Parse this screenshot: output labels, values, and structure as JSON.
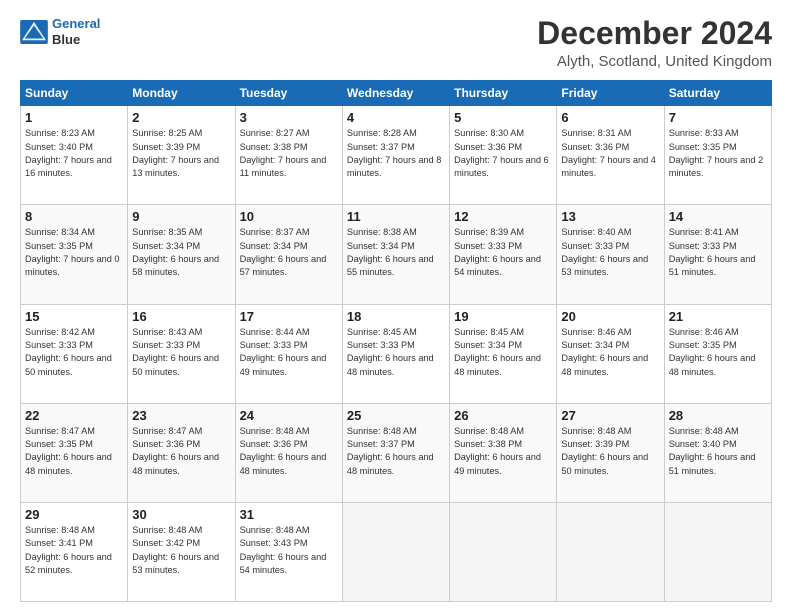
{
  "header": {
    "logo_line1": "General",
    "logo_line2": "Blue",
    "main_title": "December 2024",
    "subtitle": "Alyth, Scotland, United Kingdom"
  },
  "days_of_week": [
    "Sunday",
    "Monday",
    "Tuesday",
    "Wednesday",
    "Thursday",
    "Friday",
    "Saturday"
  ],
  "weeks": [
    [
      {
        "day": "1",
        "sunrise": "8:23 AM",
        "sunset": "3:40 PM",
        "daylight": "7 hours and 16 minutes."
      },
      {
        "day": "2",
        "sunrise": "8:25 AM",
        "sunset": "3:39 PM",
        "daylight": "7 hours and 13 minutes."
      },
      {
        "day": "3",
        "sunrise": "8:27 AM",
        "sunset": "3:38 PM",
        "daylight": "7 hours and 11 minutes."
      },
      {
        "day": "4",
        "sunrise": "8:28 AM",
        "sunset": "3:37 PM",
        "daylight": "7 hours and 8 minutes."
      },
      {
        "day": "5",
        "sunrise": "8:30 AM",
        "sunset": "3:36 PM",
        "daylight": "7 hours and 6 minutes."
      },
      {
        "day": "6",
        "sunrise": "8:31 AM",
        "sunset": "3:36 PM",
        "daylight": "7 hours and 4 minutes."
      },
      {
        "day": "7",
        "sunrise": "8:33 AM",
        "sunset": "3:35 PM",
        "daylight": "7 hours and 2 minutes."
      }
    ],
    [
      {
        "day": "8",
        "sunrise": "8:34 AM",
        "sunset": "3:35 PM",
        "daylight": "7 hours and 0 minutes."
      },
      {
        "day": "9",
        "sunrise": "8:35 AM",
        "sunset": "3:34 PM",
        "daylight": "6 hours and 58 minutes."
      },
      {
        "day": "10",
        "sunrise": "8:37 AM",
        "sunset": "3:34 PM",
        "daylight": "6 hours and 57 minutes."
      },
      {
        "day": "11",
        "sunrise": "8:38 AM",
        "sunset": "3:34 PM",
        "daylight": "6 hours and 55 minutes."
      },
      {
        "day": "12",
        "sunrise": "8:39 AM",
        "sunset": "3:33 PM",
        "daylight": "6 hours and 54 minutes."
      },
      {
        "day": "13",
        "sunrise": "8:40 AM",
        "sunset": "3:33 PM",
        "daylight": "6 hours and 53 minutes."
      },
      {
        "day": "14",
        "sunrise": "8:41 AM",
        "sunset": "3:33 PM",
        "daylight": "6 hours and 51 minutes."
      }
    ],
    [
      {
        "day": "15",
        "sunrise": "8:42 AM",
        "sunset": "3:33 PM",
        "daylight": "6 hours and 50 minutes."
      },
      {
        "day": "16",
        "sunrise": "8:43 AM",
        "sunset": "3:33 PM",
        "daylight": "6 hours and 50 minutes."
      },
      {
        "day": "17",
        "sunrise": "8:44 AM",
        "sunset": "3:33 PM",
        "daylight": "6 hours and 49 minutes."
      },
      {
        "day": "18",
        "sunrise": "8:45 AM",
        "sunset": "3:33 PM",
        "daylight": "6 hours and 48 minutes."
      },
      {
        "day": "19",
        "sunrise": "8:45 AM",
        "sunset": "3:34 PM",
        "daylight": "6 hours and 48 minutes."
      },
      {
        "day": "20",
        "sunrise": "8:46 AM",
        "sunset": "3:34 PM",
        "daylight": "6 hours and 48 minutes."
      },
      {
        "day": "21",
        "sunrise": "8:46 AM",
        "sunset": "3:35 PM",
        "daylight": "6 hours and 48 minutes."
      }
    ],
    [
      {
        "day": "22",
        "sunrise": "8:47 AM",
        "sunset": "3:35 PM",
        "daylight": "6 hours and 48 minutes."
      },
      {
        "day": "23",
        "sunrise": "8:47 AM",
        "sunset": "3:36 PM",
        "daylight": "6 hours and 48 minutes."
      },
      {
        "day": "24",
        "sunrise": "8:48 AM",
        "sunset": "3:36 PM",
        "daylight": "6 hours and 48 minutes."
      },
      {
        "day": "25",
        "sunrise": "8:48 AM",
        "sunset": "3:37 PM",
        "daylight": "6 hours and 48 minutes."
      },
      {
        "day": "26",
        "sunrise": "8:48 AM",
        "sunset": "3:38 PM",
        "daylight": "6 hours and 49 minutes."
      },
      {
        "day": "27",
        "sunrise": "8:48 AM",
        "sunset": "3:39 PM",
        "daylight": "6 hours and 50 minutes."
      },
      {
        "day": "28",
        "sunrise": "8:48 AM",
        "sunset": "3:40 PM",
        "daylight": "6 hours and 51 minutes."
      }
    ],
    [
      {
        "day": "29",
        "sunrise": "8:48 AM",
        "sunset": "3:41 PM",
        "daylight": "6 hours and 52 minutes."
      },
      {
        "day": "30",
        "sunrise": "8:48 AM",
        "sunset": "3:42 PM",
        "daylight": "6 hours and 53 minutes."
      },
      {
        "day": "31",
        "sunrise": "8:48 AM",
        "sunset": "3:43 PM",
        "daylight": "6 hours and 54 minutes."
      },
      null,
      null,
      null,
      null
    ]
  ]
}
